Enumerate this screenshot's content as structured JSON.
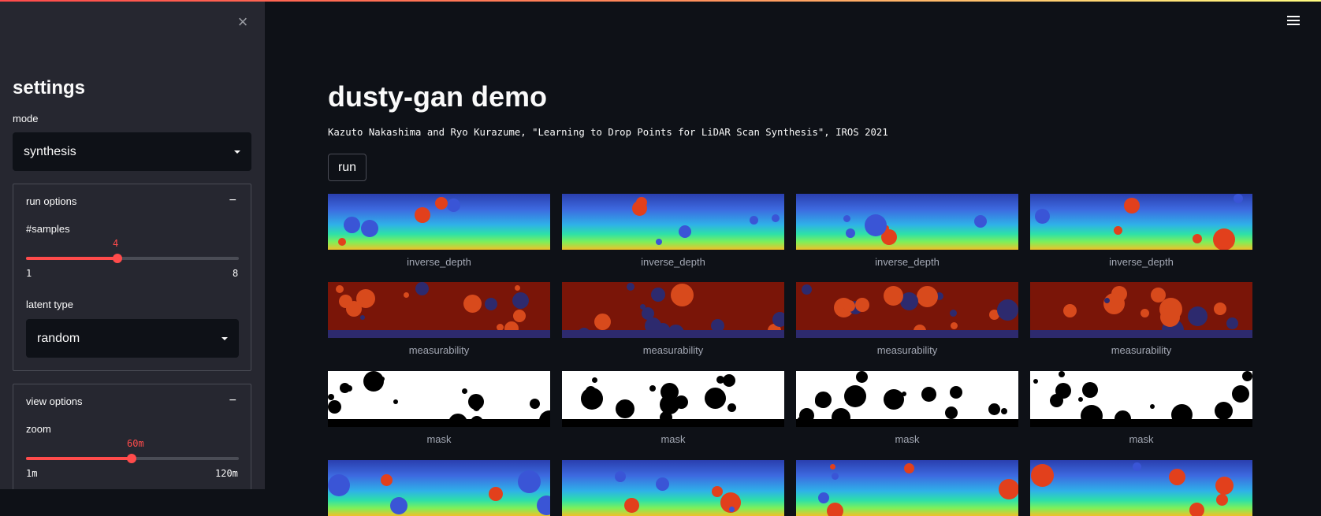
{
  "sidebar": {
    "title": "settings",
    "mode_label": "mode",
    "mode_value": "synthesis",
    "run_options": {
      "header": "run options",
      "samples_label": "#samples",
      "samples_value": "4",
      "samples_fraction": 0.4286,
      "samples_min": "1",
      "samples_max": "8",
      "latent_label": "latent type",
      "latent_value": "random"
    },
    "view_options": {
      "header": "view options",
      "zoom_label": "zoom",
      "zoom_value": "60m",
      "zoom_fraction": 0.4958,
      "zoom_min": "1m",
      "zoom_max": "120m"
    }
  },
  "main": {
    "title": "dusty-gan demo",
    "citation": "Kazuto Nakashima and Ryo Kurazume, \"Learning to Drop Points for LiDAR Scan Synthesis\", IROS 2021",
    "run_label": "run",
    "rows": [
      {
        "kind": "depth",
        "captions": [
          "inverse_depth",
          "inverse_depth",
          "inverse_depth",
          "inverse_depth"
        ]
      },
      {
        "kind": "meas",
        "captions": [
          "measurability",
          "measurability",
          "measurability",
          "measurability"
        ]
      },
      {
        "kind": "mask",
        "captions": [
          "mask",
          "mask",
          "mask",
          "mask"
        ]
      },
      {
        "kind": "depth",
        "captions": [
          "",
          "",
          "",
          ""
        ]
      }
    ]
  },
  "colors": {
    "accent": "#ff4b4b",
    "sidebar_bg": "#262730",
    "main_bg": "#0e1117"
  },
  "icons": [
    "close-icon",
    "hamburger-menu-icon",
    "chevron-down-icon",
    "minus-icon"
  ]
}
